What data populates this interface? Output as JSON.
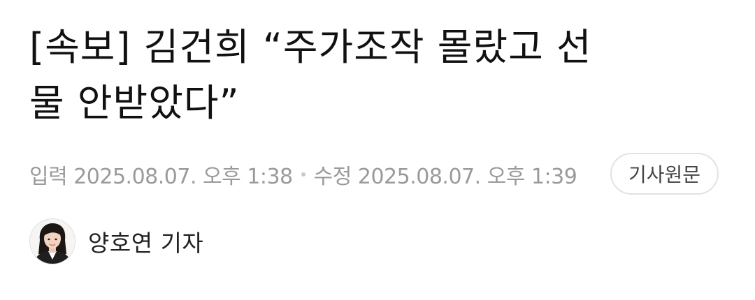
{
  "article": {
    "headline_line1": "[속보] 김건희 “주가조작 몰랐고 선",
    "headline_line2": "물 안받았다”",
    "input_label": "입력",
    "input_datetime": "2025.08.07. 오후 1:38",
    "modified_label": "수정",
    "modified_datetime": "2025.08.07. 오후 1:39",
    "original_button_label": "기사원문",
    "reporter_name": "양호연 기자"
  },
  "colors": {
    "headline": "#111111",
    "meta_text": "#9a9a9a",
    "button_border": "#e2e2e2"
  },
  "icons": {
    "avatar": "reporter-photo"
  }
}
